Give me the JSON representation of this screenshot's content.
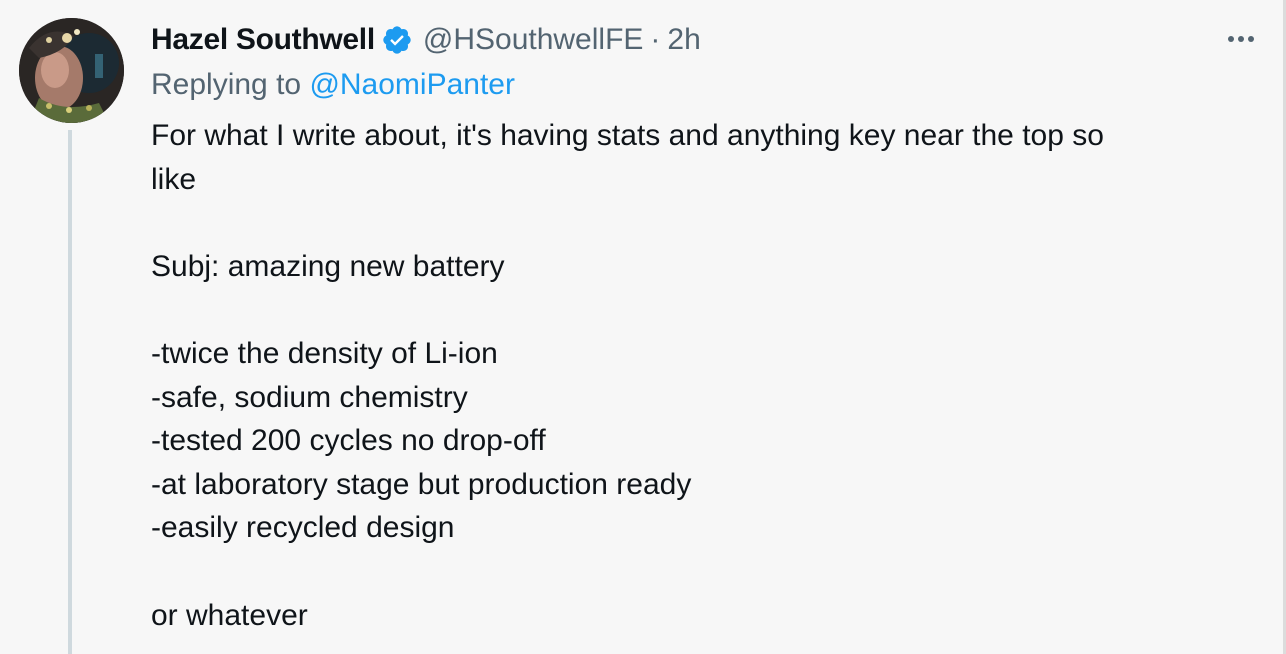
{
  "tweet": {
    "display_name": "Hazel Southwell",
    "handle": "@HSouthwellFE",
    "separator": "·",
    "time": "2h",
    "replying_label": "Replying to",
    "replying_to": "@NaomiPanter",
    "text": {
      "line1": "For what I write about, it's having stats and anything key near the top so",
      "line2": "like",
      "subject": "Subj: amazing new battery",
      "points": [
        "-twice the density of Li-ion",
        "-safe, sodium chemistry",
        "-tested 200 cycles no drop-off",
        "-at laboratory stage but production ready",
        "-easily recycled design"
      ],
      "closing": "or whatever"
    }
  },
  "icons": {
    "avatar": "user-avatar",
    "verified": "verified-badge-icon",
    "more": "more-options-icon"
  },
  "colors": {
    "link": "#1d9bf0",
    "secondary_text": "#536471",
    "primary_text": "#0f1419",
    "background": "#f7f7f7"
  }
}
